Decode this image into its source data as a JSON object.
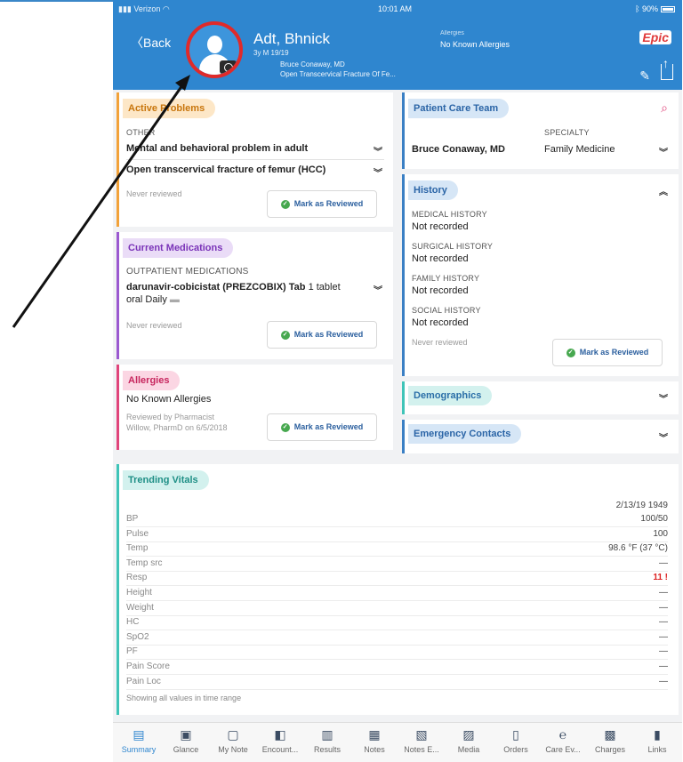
{
  "status": {
    "carrier": "Verizon",
    "time": "10:01 AM",
    "battery": "90%"
  },
  "header": {
    "back_label": "Back",
    "patient_name": "Adt, Bhnick",
    "patient_sub": "3y M  19/19",
    "provider": "Bruce Conaway, MD",
    "diagnosis": "Open Transcervical Fracture Of Fe...",
    "allergies_label": "Allergies",
    "allergies_value": "No Known Allergies",
    "brand": "Epic"
  },
  "active_problems": {
    "title": "Active Problems",
    "section": "OTHER",
    "items": [
      "Mental and behavioral problem in adult",
      "Open transcervical fracture of femur (HCC)"
    ],
    "review_status": "Never reviewed",
    "review_button": "Mark as Reviewed"
  },
  "medications": {
    "title": "Current Medications",
    "section": "OUTPATIENT MEDICATIONS",
    "drug": "darunavir-cobicistat (PREZCOBIX) Tab",
    "dose": "1 tablet",
    "route": "oral Daily",
    "review_status": "Never reviewed",
    "review_button": "Mark as Reviewed"
  },
  "allergies": {
    "title": "Allergies",
    "value": "No Known Allergies",
    "reviewed_line1": "Reviewed by Pharmacist",
    "reviewed_line2": "Willow, PharmD on 6/5/2018",
    "review_button": "Mark as Reviewed"
  },
  "care_team": {
    "title": "Patient Care Team",
    "specialty_header": "SPECIALTY",
    "member": "Bruce Conaway, MD",
    "specialty": "Family Medicine"
  },
  "history": {
    "title": "History",
    "sections": [
      {
        "label": "MEDICAL HISTORY",
        "value": "Not recorded"
      },
      {
        "label": "SURGICAL HISTORY",
        "value": "Not recorded"
      },
      {
        "label": "FAMILY HISTORY",
        "value": "Not recorded"
      },
      {
        "label": "SOCIAL HISTORY",
        "value": "Not recorded"
      }
    ],
    "review_status": "Never reviewed",
    "review_button": "Mark as Reviewed"
  },
  "demographics": {
    "title": "Demographics"
  },
  "emergency_contacts": {
    "title": "Emergency Contacts"
  },
  "vitals": {
    "title": "Trending Vitals",
    "column_header": "2/13/19 1949",
    "rows": [
      {
        "label": "BP",
        "value": "100/50"
      },
      {
        "label": "Pulse",
        "value": "100"
      },
      {
        "label": "Temp",
        "value": "98.6 °F (37 °C)"
      },
      {
        "label": "Temp src",
        "value": "—"
      },
      {
        "label": "Resp",
        "value": "11 !"
      },
      {
        "label": "Height",
        "value": "—"
      },
      {
        "label": "Weight",
        "value": "—"
      },
      {
        "label": "HC",
        "value": "—"
      },
      {
        "label": "SpO2",
        "value": "—"
      },
      {
        "label": "PF",
        "value": "—"
      },
      {
        "label": "Pain Score",
        "value": "—"
      },
      {
        "label": "Pain Loc",
        "value": "—"
      }
    ],
    "footer": "Showing all values in time range"
  },
  "tabs": [
    {
      "label": "Summary",
      "icon": "summary-icon"
    },
    {
      "label": "Glance",
      "icon": "glance-icon"
    },
    {
      "label": "My Note",
      "icon": "my-note-icon"
    },
    {
      "label": "Encount...",
      "icon": "encounter-icon"
    },
    {
      "label": "Results",
      "icon": "results-icon"
    },
    {
      "label": "Notes",
      "icon": "notes-icon"
    },
    {
      "label": "Notes E...",
      "icon": "notes-edit-icon"
    },
    {
      "label": "Media",
      "icon": "media-icon"
    },
    {
      "label": "Orders",
      "icon": "orders-icon"
    },
    {
      "label": "Care Ev...",
      "icon": "care-everywhere-icon"
    },
    {
      "label": "Charges",
      "icon": "charges-icon"
    },
    {
      "label": "Links",
      "icon": "links-icon"
    }
  ],
  "colors": {
    "header_blue": "#2f86cf",
    "problems_orange": "#f2a23a",
    "meds_purple": "#9b59d0",
    "allergies_pink": "#e0457b",
    "care_blue": "#3a7fc4",
    "vitals_teal": "#3fc4b8",
    "callout_red": "#e02a2a"
  }
}
